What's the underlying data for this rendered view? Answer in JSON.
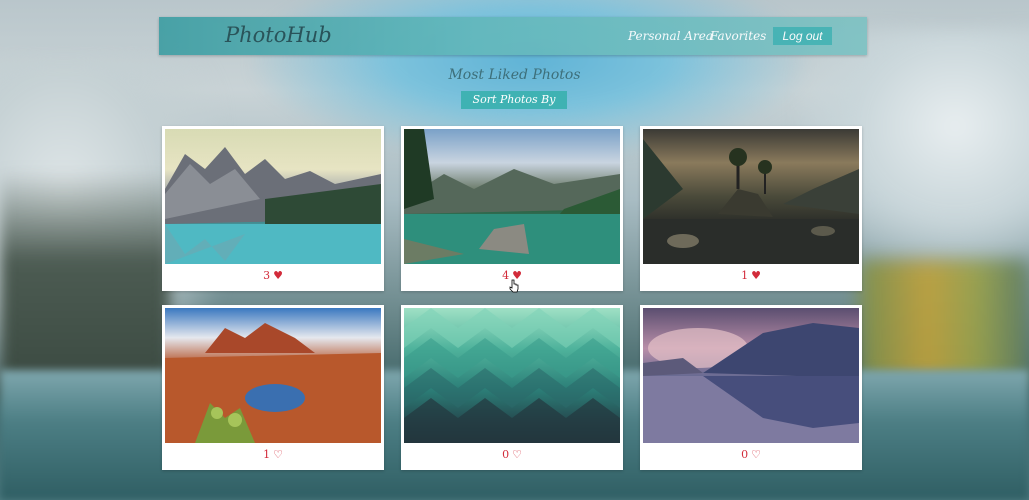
{
  "navbar": {
    "brand": "PhotoHub",
    "links": [
      "Personal Area",
      "Favorites"
    ],
    "logout_label": "Log out"
  },
  "main": {
    "title": "Most Liked Photos",
    "sort_label": "Sort Photos By"
  },
  "photos": [
    {
      "likes": "3",
      "heart": "♥",
      "liked": true,
      "subject": "mountain-lake-photo"
    },
    {
      "likes": "4",
      "heart": "♥",
      "liked": true,
      "subject": "green-lake-rock-photo"
    },
    {
      "likes": "1",
      "heart": "♥",
      "liked": true,
      "subject": "stormy-lake-island-photo"
    },
    {
      "likes": "1",
      "heart": "♡",
      "liked": false,
      "subject": "red-rock-desert-photo"
    },
    {
      "likes": "0",
      "heart": "♡",
      "liked": false,
      "subject": "teal-geometric-pattern-photo"
    },
    {
      "likes": "0",
      "heart": "♡",
      "liked": false,
      "subject": "misty-purple-lake-photo"
    }
  ],
  "colors": {
    "accent": "#3fb2b3",
    "like": "#d22b3a",
    "brand_text": "#1e4a50"
  }
}
